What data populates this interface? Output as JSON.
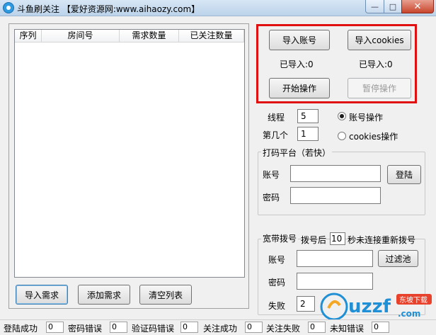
{
  "window": {
    "title": "斗鱼刷关注   【爱好资源网:www.aihaozy.com】",
    "minimize": "—",
    "maximize": "□",
    "close": "✕"
  },
  "list": {
    "columns": [
      "序列",
      "房间号",
      "需求数量",
      "已关注数量"
    ]
  },
  "left_buttons": {
    "import_demand": "导入需求",
    "add_demand": "添加需求",
    "clear_list": "清空列表"
  },
  "import": {
    "import_accounts": "导入账号",
    "import_cookies": "导入cookies",
    "accounts_imported": "已导入:0",
    "cookies_imported": "已导入:0",
    "start": "开始操作",
    "pause": "暂停操作"
  },
  "settings": {
    "threads_label": "线程",
    "threads_value": "5",
    "index_label": "第几个",
    "index_value": "1",
    "radio_account": "账号操作",
    "radio_cookies": "cookies操作"
  },
  "captcha": {
    "title": "打码平台（若快）",
    "account_label": "账号",
    "password_label": "密码",
    "account_value": "",
    "password_value": "",
    "login": "登陆"
  },
  "broadband": {
    "title": "宽带拨号",
    "dial_prefix": "拨号后",
    "dial_seconds": "10",
    "dial_suffix": "秒未连接重新拨号",
    "account_label": "账号",
    "password_label": "密码",
    "fail_label": "失败",
    "fail_value": "2",
    "filter_pool": "过滤池"
  },
  "status": {
    "login_success_label": "登陆成功",
    "login_success": "0",
    "password_error_label": "密码错误",
    "password_error": "0",
    "captcha_error_label": "验证码错误",
    "captcha_error": "0",
    "follow_success_label": "关注成功",
    "follow_success": "0",
    "follow_fail_label": "关注失败",
    "follow_fail": "0",
    "unknown_error_label": "未知错误",
    "unknown_error": "0"
  },
  "watermark": {
    "text": "uzzf",
    "sub": ".com",
    "tag": "东坡下载"
  }
}
